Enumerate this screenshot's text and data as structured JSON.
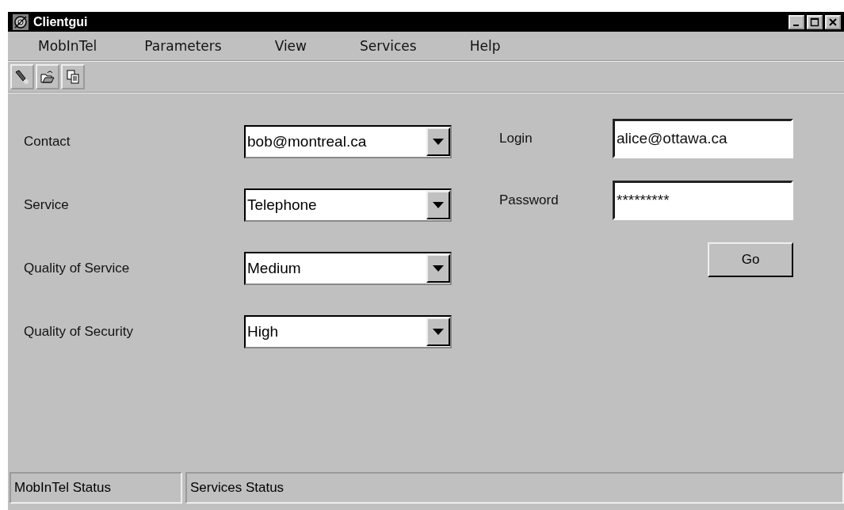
{
  "window": {
    "title": "Clientgui"
  },
  "menu": [
    "MobInTel",
    "Parameters",
    "View",
    "Services",
    "Help"
  ],
  "toolbar": [
    {
      "kind": "flashlight"
    },
    {
      "kind": "open"
    },
    {
      "kind": "copy"
    }
  ],
  "form": {
    "selects": [
      {
        "label": "Contact",
        "value": "bob@montreal.ca"
      },
      {
        "label": "Service",
        "value": "Telephone"
      },
      {
        "label": "Quality of Service",
        "value": "Medium"
      },
      {
        "label": "Quality of Security",
        "value": "High"
      }
    ],
    "login": {
      "label": "Login",
      "value": "alice@ottawa.ca"
    },
    "password": {
      "label": "Password",
      "value": "*********"
    },
    "go_button": "Go"
  },
  "status_bar": [
    "MobInTel Status",
    "Services Status"
  ]
}
